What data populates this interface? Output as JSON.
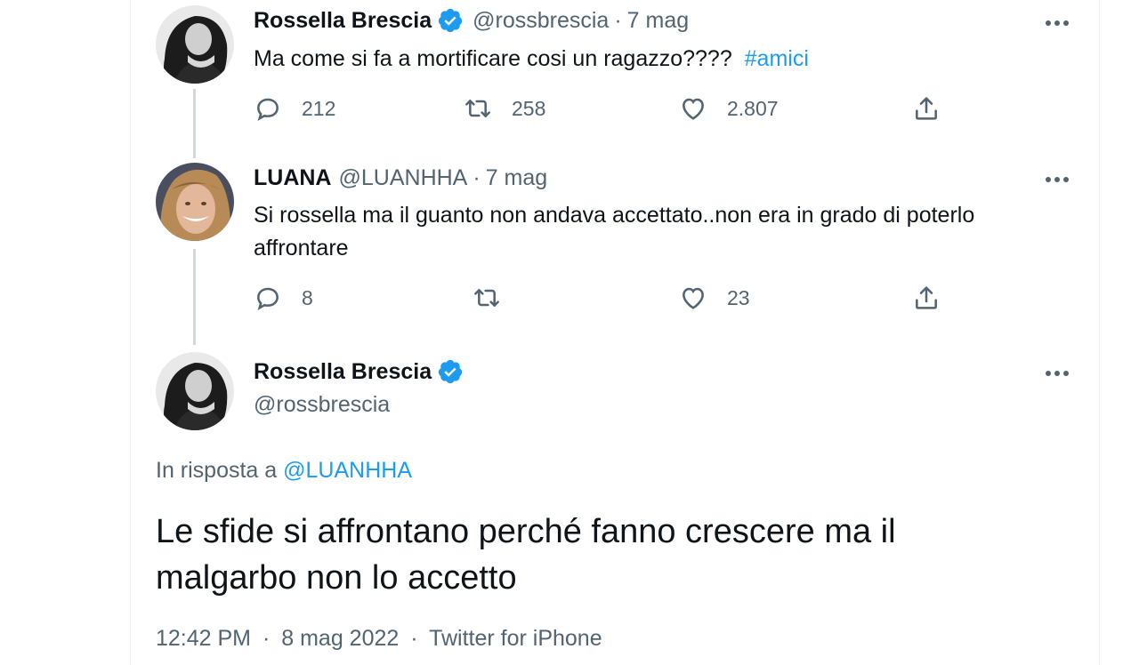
{
  "tweets": [
    {
      "name": "Rossella Brescia",
      "verified": true,
      "handle": "@rossbrescia",
      "date": "7 mag",
      "text": "Ma come si fa a mortificare cosi un ragazzo????",
      "hashtag": "#amici",
      "stats": {
        "replies": "212",
        "retweets": "258",
        "likes": "2.807"
      }
    },
    {
      "name": "LUANA",
      "verified": false,
      "handle": "@LUANHHA",
      "date": "7 mag",
      "text_line1": "Si rossella ma il guanto non andava accettato..non era in grado di poterlo",
      "text_line2": "affrontare",
      "stats": {
        "replies": "8",
        "retweets": "",
        "likes": "23"
      }
    }
  ],
  "main_tweet": {
    "name": "Rossella Brescia",
    "verified": true,
    "handle": "@rossbrescia",
    "reply_prefix": "In risposta a",
    "reply_to": "@LUANHHA",
    "text_line1": "Le sfide si affrontano perché fanno crescere ma il",
    "text_line2": "malgarbo non lo accetto",
    "time": "12:42 PM",
    "date": "8 mag 2022",
    "source": "Twitter for iPhone"
  },
  "separator": "·",
  "colors": {
    "accent": "#1d9bf0",
    "secondary_text": "#536471",
    "thread_line": "#cfd9de"
  },
  "icons": [
    "reply-icon",
    "retweet-icon",
    "like-icon",
    "share-icon",
    "more-icon",
    "verified-badge-icon"
  ]
}
